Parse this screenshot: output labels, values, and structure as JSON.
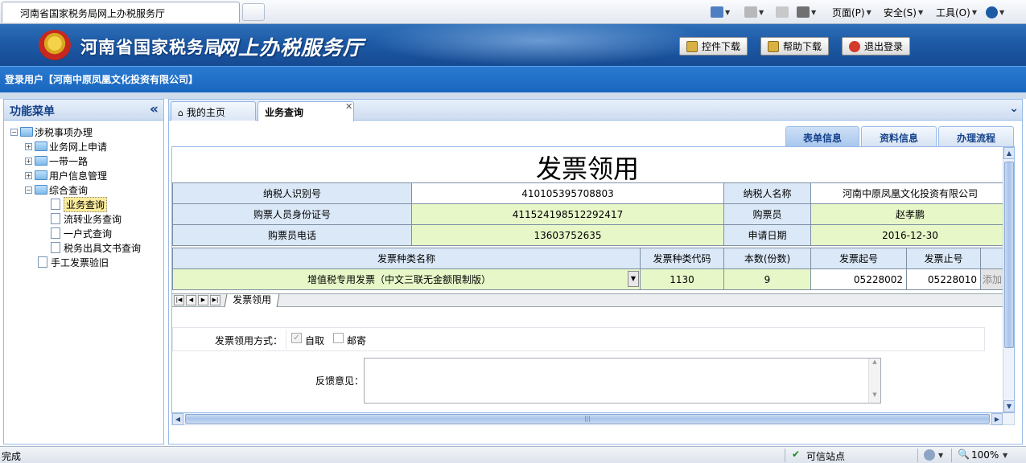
{
  "browser": {
    "tab_title": "河南省国家税务局网上办税服务厅",
    "commands": {
      "page": "页面(P)",
      "safety": "安全(S)",
      "tools": "工具(O)"
    }
  },
  "banner": {
    "title_main": "河南省国家税务局",
    "title_sub": "网上办税服务厅",
    "buttons": {
      "control_download": "控件下载",
      "help_download": "帮助下载",
      "logout": "退出登录"
    }
  },
  "user": {
    "login_text": "登录用户【河南中原凤凰文化投资有限公司】"
  },
  "menu": {
    "title": "功能菜单",
    "tree": {
      "root": "涉税事项办理",
      "online_apply": "业务网上申请",
      "belt_road": "一带一路",
      "user_info": "用户信息管理",
      "comprehensive": "综合查询",
      "business_query": "业务查询",
      "transfer_query": "流转业务查询",
      "one_stop_query": "一户式查询",
      "tax_doc_query": "税务出具文书查询",
      "manual_invoice": "手工发票验旧"
    }
  },
  "tabs": {
    "home": "我的主页",
    "query": "业务查询"
  },
  "right_tabs": {
    "form_info": "表单信息",
    "material_info": "资料信息",
    "process": "办理流程"
  },
  "form": {
    "title": "发票领用",
    "labels": {
      "taxpayer_id": "纳税人识别号",
      "taxpayer_name": "纳税人名称",
      "buyer_idcard": "购票人员身份证号",
      "buyer": "购票员",
      "buyer_phone": "购票员电话",
      "apply_date": "申请日期"
    },
    "values": {
      "taxpayer_id": "410105395708803",
      "taxpayer_name": "河南中原凤凰文化投资有限公司",
      "buyer_idcard": "411524198512292417",
      "buyer": "赵孝鹏",
      "buyer_phone": "13603752635",
      "apply_date": "2016-12-30"
    },
    "invoice_headers": {
      "type_name": "发票种类名称",
      "type_code": "发票种类代码",
      "count": "本数(份数)",
      "start_no": "发票起号",
      "end_no": "发票止号"
    },
    "invoice_row": {
      "type_name": "增值税专用发票（中文三联无金额限制版）",
      "type_code": "1130",
      "count": "9",
      "start_no": "05228002",
      "end_no": "05228010",
      "add": "添加"
    },
    "sheet_tab": "发票领用",
    "method_label": "发票领用方式：",
    "method_self": "自取",
    "method_mail": "邮寄",
    "method_self_checked": true,
    "method_mail_checked": false,
    "feedback_label": "反馈意见："
  },
  "status": {
    "left": "完成",
    "trusted": "可信站点",
    "zoom": "100%"
  }
}
